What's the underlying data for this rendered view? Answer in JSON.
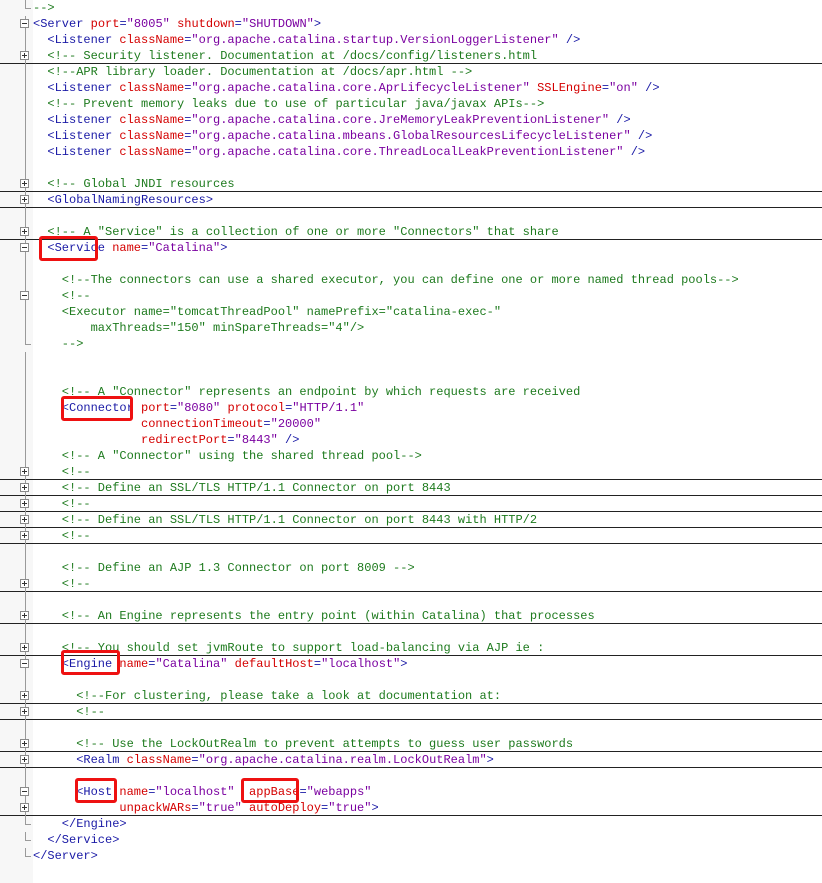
{
  "editor": {
    "lines": [
      {
        "indent": 0,
        "fold": "end",
        "tokens": [
          {
            "t": "com",
            "v": "-->"
          }
        ]
      },
      {
        "indent": 0,
        "fold": "open",
        "tokens": [
          {
            "t": "tag",
            "v": "<Server"
          },
          {
            "t": "plain",
            "v": " "
          },
          {
            "t": "attr",
            "v": "port"
          },
          {
            "t": "tag",
            "v": "="
          },
          {
            "t": "val",
            "v": "\"8005\""
          },
          {
            "t": "plain",
            "v": " "
          },
          {
            "t": "attr",
            "v": "shutdown"
          },
          {
            "t": "tag",
            "v": "="
          },
          {
            "t": "val",
            "v": "\"SHUTDOWN\""
          },
          {
            "t": "tag",
            "v": ">"
          }
        ]
      },
      {
        "indent": 2,
        "fold": "line",
        "tokens": [
          {
            "t": "tag",
            "v": "<Listener"
          },
          {
            "t": "plain",
            "v": " "
          },
          {
            "t": "attr",
            "v": "className"
          },
          {
            "t": "tag",
            "v": "="
          },
          {
            "t": "val",
            "v": "\"org.apache.catalina.startup.VersionLoggerListener\""
          },
          {
            "t": "plain",
            "v": " "
          },
          {
            "t": "tag",
            "v": "/>"
          }
        ]
      },
      {
        "indent": 2,
        "fold": "collapsed",
        "sep": true,
        "tokens": [
          {
            "t": "com",
            "v": "<!-- Security listener. Documentation at /docs/config/listeners.html"
          }
        ]
      },
      {
        "indent": 2,
        "fold": "line",
        "tokens": [
          {
            "t": "com",
            "v": "<!--APR library loader. Documentation at /docs/apr.html -->"
          }
        ]
      },
      {
        "indent": 2,
        "fold": "line",
        "tokens": [
          {
            "t": "tag",
            "v": "<Listener"
          },
          {
            "t": "plain",
            "v": " "
          },
          {
            "t": "attr",
            "v": "className"
          },
          {
            "t": "tag",
            "v": "="
          },
          {
            "t": "val",
            "v": "\"org.apache.catalina.core.AprLifecycleListener\""
          },
          {
            "t": "plain",
            "v": " "
          },
          {
            "t": "attr",
            "v": "SSLEngine"
          },
          {
            "t": "tag",
            "v": "="
          },
          {
            "t": "val",
            "v": "\"on\""
          },
          {
            "t": "plain",
            "v": " "
          },
          {
            "t": "tag",
            "v": "/>"
          }
        ]
      },
      {
        "indent": 2,
        "fold": "line",
        "tokens": [
          {
            "t": "com",
            "v": "<!-- Prevent memory leaks due to use of particular java/javax APIs-->"
          }
        ]
      },
      {
        "indent": 2,
        "fold": "line",
        "tokens": [
          {
            "t": "tag",
            "v": "<Listener"
          },
          {
            "t": "plain",
            "v": " "
          },
          {
            "t": "attr",
            "v": "className"
          },
          {
            "t": "tag",
            "v": "="
          },
          {
            "t": "val",
            "v": "\"org.apache.catalina.core.JreMemoryLeakPreventionListener\""
          },
          {
            "t": "plain",
            "v": " "
          },
          {
            "t": "tag",
            "v": "/>"
          }
        ]
      },
      {
        "indent": 2,
        "fold": "line",
        "tokens": [
          {
            "t": "tag",
            "v": "<Listener"
          },
          {
            "t": "plain",
            "v": " "
          },
          {
            "t": "attr",
            "v": "className"
          },
          {
            "t": "tag",
            "v": "="
          },
          {
            "t": "val",
            "v": "\"org.apache.catalina.mbeans.GlobalResourcesLifecycleListener\""
          },
          {
            "t": "plain",
            "v": " "
          },
          {
            "t": "tag",
            "v": "/>"
          }
        ]
      },
      {
        "indent": 2,
        "fold": "line",
        "tokens": [
          {
            "t": "tag",
            "v": "<Listener"
          },
          {
            "t": "plain",
            "v": " "
          },
          {
            "t": "attr",
            "v": "className"
          },
          {
            "t": "tag",
            "v": "="
          },
          {
            "t": "val",
            "v": "\"org.apache.catalina.core.ThreadLocalLeakPreventionListener\""
          },
          {
            "t": "plain",
            "v": " "
          },
          {
            "t": "tag",
            "v": "/>"
          }
        ]
      },
      {
        "indent": 0,
        "fold": "line",
        "tokens": []
      },
      {
        "indent": 2,
        "fold": "collapsed",
        "sep": true,
        "tokens": [
          {
            "t": "com",
            "v": "<!-- Global JNDI resources"
          }
        ]
      },
      {
        "indent": 2,
        "fold": "collapsed",
        "sep": true,
        "tokens": [
          {
            "t": "tag",
            "v": "<GlobalNamingResources>"
          }
        ]
      },
      {
        "indent": 0,
        "fold": "line",
        "tokens": []
      },
      {
        "indent": 2,
        "fold": "collapsed",
        "sep": true,
        "tokens": [
          {
            "t": "com",
            "v": "<!-- A \"Service\" is a collection of one or more \"Connectors\" that share"
          }
        ]
      },
      {
        "indent": 2,
        "fold": "open",
        "tokens": [
          {
            "t": "tag",
            "v": "<Service"
          },
          {
            "t": "plain",
            "v": " "
          },
          {
            "t": "attr",
            "v": "name"
          },
          {
            "t": "tag",
            "v": "="
          },
          {
            "t": "val",
            "v": "\"Catalina\""
          },
          {
            "t": "tag",
            "v": ">"
          }
        ]
      },
      {
        "indent": 0,
        "fold": "line",
        "tokens": []
      },
      {
        "indent": 4,
        "fold": "line",
        "tokens": [
          {
            "t": "com",
            "v": "<!--The connectors can use a shared executor, you can define one or more named thread pools-->"
          }
        ]
      },
      {
        "indent": 4,
        "fold": "open",
        "tokens": [
          {
            "t": "com",
            "v": "<!--"
          }
        ]
      },
      {
        "indent": 4,
        "fold": "line",
        "tokens": [
          {
            "t": "com",
            "v": "<Executor name=\"tomcatThreadPool\" namePrefix=\"catalina-exec-\""
          }
        ]
      },
      {
        "indent": 8,
        "fold": "line",
        "tokens": [
          {
            "t": "com",
            "v": "maxThreads=\"150\" minSpareThreads=\"4\"/>"
          }
        ]
      },
      {
        "indent": 4,
        "fold": "end",
        "tokens": [
          {
            "t": "com",
            "v": "-->"
          }
        ]
      },
      {
        "indent": 0,
        "fold": "line",
        "tokens": []
      },
      {
        "indent": 0,
        "fold": "line",
        "tokens": []
      },
      {
        "indent": 4,
        "fold": "line",
        "tokens": [
          {
            "t": "com",
            "v": "<!-- A \"Connector\" represents an endpoint by which requests are received"
          }
        ]
      },
      {
        "indent": 4,
        "fold": "line",
        "tokens": [
          {
            "t": "tag",
            "v": "<Connector"
          },
          {
            "t": "plain",
            "v": " "
          },
          {
            "t": "attr",
            "v": "port"
          },
          {
            "t": "tag",
            "v": "="
          },
          {
            "t": "val",
            "v": "\"8080\""
          },
          {
            "t": "plain",
            "v": " "
          },
          {
            "t": "attr",
            "v": "protocol"
          },
          {
            "t": "tag",
            "v": "="
          },
          {
            "t": "val",
            "v": "\"HTTP/1.1\""
          }
        ]
      },
      {
        "indent": 15,
        "fold": "line",
        "tokens": [
          {
            "t": "attr",
            "v": "connectionTimeout"
          },
          {
            "t": "tag",
            "v": "="
          },
          {
            "t": "val",
            "v": "\"20000\""
          }
        ]
      },
      {
        "indent": 15,
        "fold": "line",
        "tokens": [
          {
            "t": "attr",
            "v": "redirectPort"
          },
          {
            "t": "tag",
            "v": "="
          },
          {
            "t": "val",
            "v": "\"8443\""
          },
          {
            "t": "plain",
            "v": " "
          },
          {
            "t": "tag",
            "v": "/>"
          }
        ]
      },
      {
        "indent": 4,
        "fold": "line",
        "tokens": [
          {
            "t": "com",
            "v": "<!-- A \"Connector\" using the shared thread pool-->"
          }
        ]
      },
      {
        "indent": 4,
        "fold": "collapsed",
        "sep": true,
        "tokens": [
          {
            "t": "com",
            "v": "<!--"
          }
        ]
      },
      {
        "indent": 4,
        "fold": "collapsed",
        "sep": true,
        "tokens": [
          {
            "t": "com",
            "v": "<!-- Define an SSL/TLS HTTP/1.1 Connector on port 8443"
          }
        ]
      },
      {
        "indent": 4,
        "fold": "collapsed",
        "sep": true,
        "tokens": [
          {
            "t": "com",
            "v": "<!--"
          }
        ]
      },
      {
        "indent": 4,
        "fold": "collapsed",
        "sep": true,
        "tokens": [
          {
            "t": "com",
            "v": "<!-- Define an SSL/TLS HTTP/1.1 Connector on port 8443 with HTTP/2"
          }
        ]
      },
      {
        "indent": 4,
        "fold": "collapsed",
        "sep": true,
        "tokens": [
          {
            "t": "com",
            "v": "<!--"
          }
        ]
      },
      {
        "indent": 0,
        "fold": "line",
        "tokens": []
      },
      {
        "indent": 4,
        "fold": "line",
        "tokens": [
          {
            "t": "com",
            "v": "<!-- Define an AJP 1.3 Connector on port 8009 -->"
          }
        ]
      },
      {
        "indent": 4,
        "fold": "collapsed",
        "sep": true,
        "tokens": [
          {
            "t": "com",
            "v": "<!--"
          }
        ]
      },
      {
        "indent": 0,
        "fold": "line",
        "tokens": []
      },
      {
        "indent": 4,
        "fold": "collapsed",
        "sep": true,
        "tokens": [
          {
            "t": "com",
            "v": "<!-- An Engine represents the entry point (within Catalina) that processes"
          }
        ]
      },
      {
        "indent": 0,
        "fold": "line",
        "tokens": []
      },
      {
        "indent": 4,
        "fold": "collapsed",
        "sep": true,
        "tokens": [
          {
            "t": "com",
            "v": "<!-- You should set jvmRoute to support load-balancing via AJP ie :"
          }
        ]
      },
      {
        "indent": 4,
        "fold": "open",
        "tokens": [
          {
            "t": "tag",
            "v": "<Engine"
          },
          {
            "t": "plain",
            "v": " "
          },
          {
            "t": "attr",
            "v": "name"
          },
          {
            "t": "tag",
            "v": "="
          },
          {
            "t": "val",
            "v": "\"Catalina\""
          },
          {
            "t": "plain",
            "v": " "
          },
          {
            "t": "attr",
            "v": "defaultHost"
          },
          {
            "t": "tag",
            "v": "="
          },
          {
            "t": "val",
            "v": "\"localhost\""
          },
          {
            "t": "tag",
            "v": ">"
          }
        ]
      },
      {
        "indent": 0,
        "fold": "line",
        "tokens": []
      },
      {
        "indent": 6,
        "fold": "collapsed",
        "sep": true,
        "tokens": [
          {
            "t": "com",
            "v": "<!--For clustering, please take a look at documentation at:"
          }
        ]
      },
      {
        "indent": 6,
        "fold": "collapsed",
        "sep": true,
        "tokens": [
          {
            "t": "com",
            "v": "<!--"
          }
        ]
      },
      {
        "indent": 0,
        "fold": "line",
        "tokens": []
      },
      {
        "indent": 6,
        "fold": "collapsed",
        "sep": true,
        "tokens": [
          {
            "t": "com",
            "v": "<!-- Use the LockOutRealm to prevent attempts to guess user passwords"
          }
        ]
      },
      {
        "indent": 6,
        "fold": "collapsed",
        "sep": true,
        "tokens": [
          {
            "t": "tag",
            "v": "<Realm"
          },
          {
            "t": "plain",
            "v": " "
          },
          {
            "t": "attr",
            "v": "className"
          },
          {
            "t": "tag",
            "v": "="
          },
          {
            "t": "val",
            "v": "\"org.apache.catalina.realm.LockOutRealm\""
          },
          {
            "t": "tag",
            "v": ">"
          }
        ]
      },
      {
        "indent": 0,
        "fold": "line",
        "tokens": []
      },
      {
        "indent": 6,
        "fold": "open",
        "tokens": [
          {
            "t": "tag",
            "v": "<Host"
          },
          {
            "t": "plain",
            "v": " "
          },
          {
            "t": "attr",
            "v": "name"
          },
          {
            "t": "tag",
            "v": "="
          },
          {
            "t": "val",
            "v": "\"localhost\""
          },
          {
            "t": "plain",
            "v": "  "
          },
          {
            "t": "attr",
            "v": "appBase"
          },
          {
            "t": "tag",
            "v": "="
          },
          {
            "t": "val",
            "v": "\"webapps\""
          }
        ]
      },
      {
        "indent": 12,
        "fold": "collapsed",
        "sep": true,
        "tokens": [
          {
            "t": "attr",
            "v": "unpackWARs"
          },
          {
            "t": "tag",
            "v": "="
          },
          {
            "t": "val",
            "v": "\"true\""
          },
          {
            "t": "plain",
            "v": " "
          },
          {
            "t": "attr",
            "v": "autoDeploy"
          },
          {
            "t": "tag",
            "v": "="
          },
          {
            "t": "val",
            "v": "\"true\""
          },
          {
            "t": "tag",
            "v": ">"
          }
        ]
      },
      {
        "indent": 4,
        "fold": "end",
        "tokens": [
          {
            "t": "tag",
            "v": "</Engine>"
          }
        ]
      },
      {
        "indent": 2,
        "fold": "end",
        "tokens": [
          {
            "t": "tag",
            "v": "</Service>"
          }
        ]
      },
      {
        "indent": 0,
        "fold": "end",
        "tokens": [
          {
            "t": "tag",
            "v": "</Server>"
          }
        ]
      }
    ]
  },
  "colors": {
    "tag": "#1a1aa6",
    "attribute": "#d40000",
    "value": "#7a00a0",
    "comment": "#1d7a1d",
    "highlight": "#ee1111"
  }
}
